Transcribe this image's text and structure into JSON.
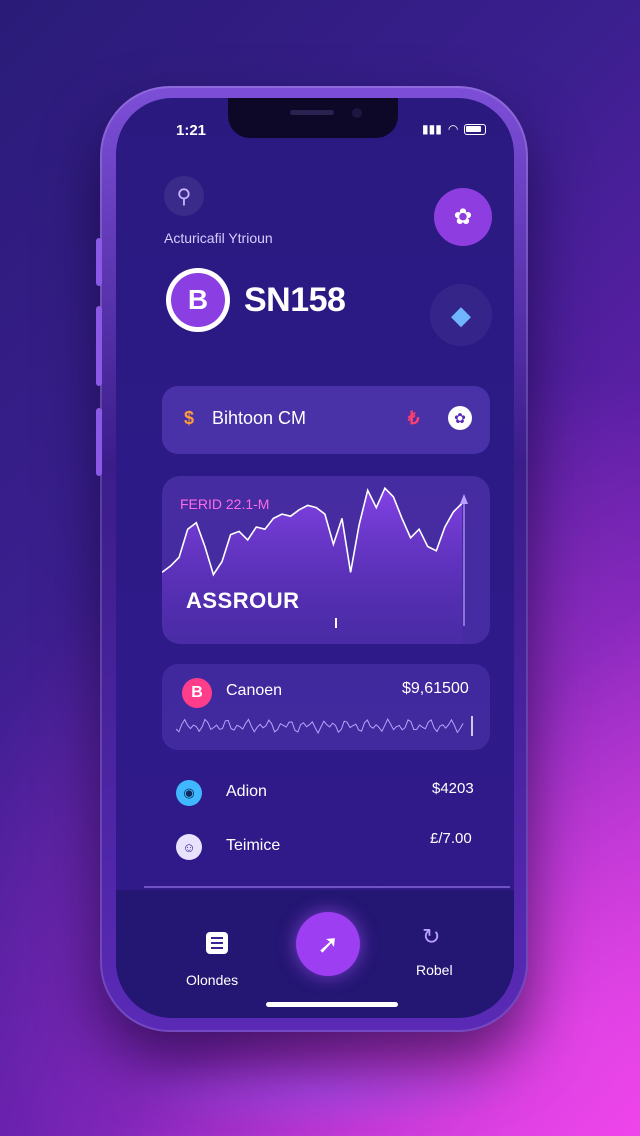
{
  "status_bar": {
    "time": "1:21"
  },
  "header": {
    "subtitle": "Acturica‍fil Ytrioun"
  },
  "coin": {
    "symbol": "SN158",
    "logo_letter": "B"
  },
  "coin_card": {
    "icon": "$",
    "label": "Bihtoon CM",
    "mark": "₺"
  },
  "chart_card": {
    "label": "FERID 22.1-M",
    "big_text": "ASSROUR"
  },
  "chart_data": {
    "type": "area",
    "title": "",
    "xlabel": "",
    "ylabel": "",
    "series": [
      {
        "values": [
          20,
          26,
          34,
          60,
          66,
          44,
          18,
          30,
          55,
          58,
          50,
          62,
          60,
          70,
          74,
          72,
          78,
          82,
          80,
          74,
          46,
          70,
          20,
          64,
          96,
          80,
          98,
          90,
          70,
          52,
          60,
          44,
          40,
          62,
          76,
          84
        ]
      }
    ],
    "ylim": [
      0,
      100
    ],
    "colors": {
      "line": "#ffffff",
      "fill": "#7b3fe0"
    }
  },
  "price_card": {
    "name": "Canoen",
    "value": "$9,61500",
    "icon": "B"
  },
  "rows": [
    {
      "name": "Adion",
      "value": "$4203"
    },
    {
      "name": "Teimice",
      "value": "£/7.00"
    }
  ],
  "bottom_nav": {
    "left_label": "Olondes",
    "right_label": "Robel"
  },
  "colors": {
    "accent": "#9d3ef2",
    "pink": "#ff3d8a",
    "background": "#2a1a80"
  }
}
